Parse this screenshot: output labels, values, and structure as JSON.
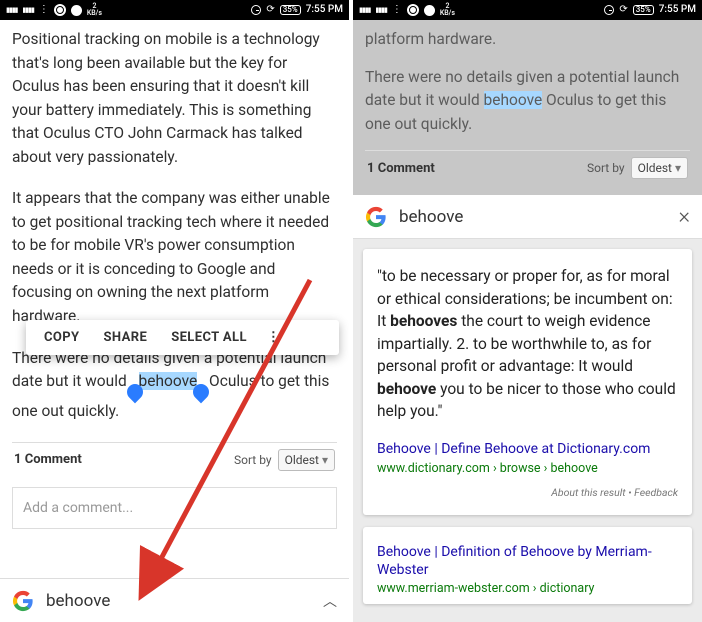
{
  "status": {
    "kbs_top": "2",
    "kbs_bot": "KB/s",
    "battery": "35%",
    "time": "7:55 PM"
  },
  "left": {
    "p1": "Positional tracking on mobile is a technology that's long been available but the key for Oculus has been ensuring that it doesn't kill your battery immediately. This is something that Oculus CTO John Carmack has talked about very passionately.",
    "p2": "It appears that the company was either unable to get positional tracking tech where it needed to be for mobile VR's power consumption needs or it is conceding to Google and focusing on owning the next platform hardware.",
    "p3a": "There were no details given a potential launch date but it would ",
    "p3b": "behoove",
    "p3c": " Oculus to get this one out quickly.",
    "ctx": {
      "copy": "COPY",
      "share": "SHARE",
      "selectall": "SELECT ALL"
    },
    "comments_count": "1 Comment",
    "sortby_label": "Sort by",
    "sortby_value": "Oldest",
    "addcomment_ph": "Add a comment...",
    "gbar_query": "behoove"
  },
  "right": {
    "p_top": "platform hardware.",
    "p3a": "There were no details given a potential launch date but it would ",
    "p3b": "behoove",
    "p3c": " Oculus to get this one out quickly.",
    "comments_count": "1 Comment",
    "sortby_label": "Sort by",
    "sortby_value": "Oldest",
    "gbar_query": "behoove",
    "def_a": "\"to be necessary or proper for, as for moral or ethical considerations; be incumbent on: It ",
    "def_b": "behooves",
    "def_c": " the court to weigh evidence impartially. 2. to be worthwhile to, as for personal profit or advantage: It would ",
    "def_d": "behoove",
    "def_e": " you to be nicer to those who could help you.\"",
    "r1_title": "Behoove | Define Behoove at Dictionary.com",
    "r1_url": "www.dictionary.com › browse › behoove",
    "meta": "About this result • Feedback",
    "r2_title": "Behoove | Definition of Behoove by Merriam-Webster",
    "r2_url": "www.merriam-webster.com › dictionary"
  },
  "colors": {
    "highlight": "#a7d8ff",
    "link": "#1a0dab",
    "url": "#0b7a0b",
    "arrow": "#d8352a"
  },
  "chart_data": null
}
